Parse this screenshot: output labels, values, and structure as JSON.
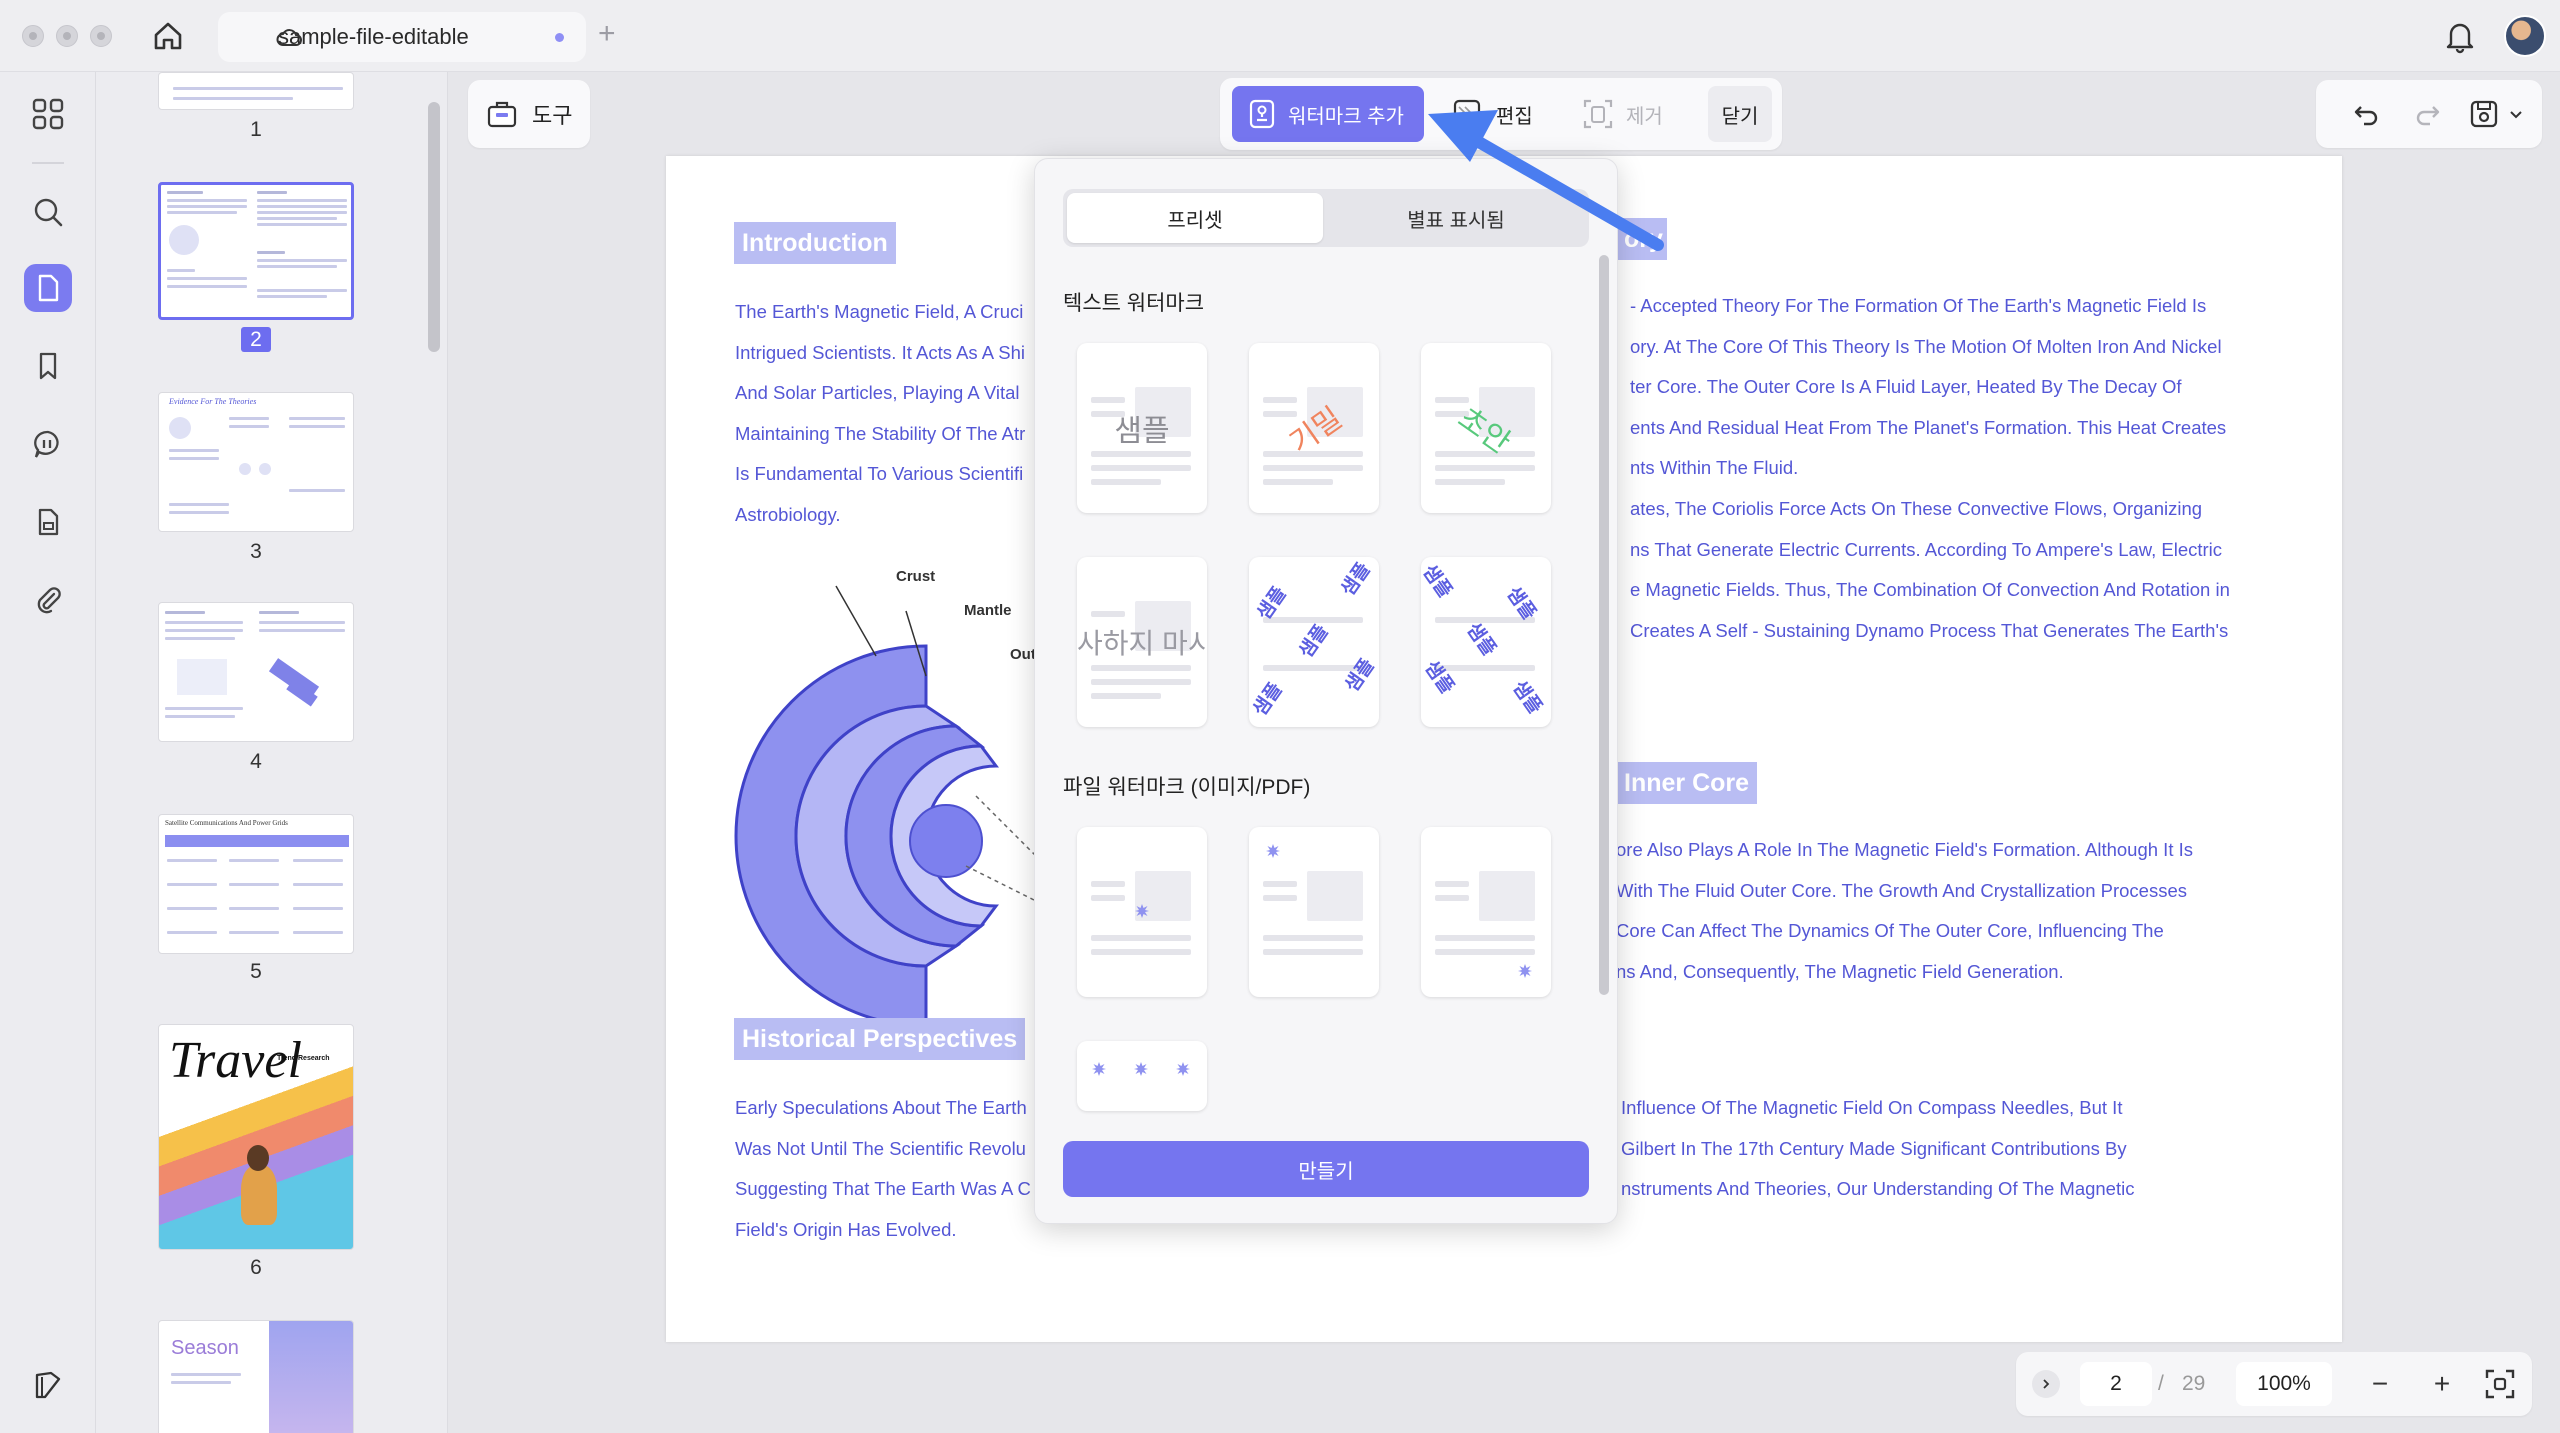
{
  "titlebar": {
    "tab_title": "sample-file-editable",
    "new_tab_symbol": "+"
  },
  "rail": {
    "icons": [
      "grid-icon",
      "search-icon",
      "page-icon",
      "bookmark-icon",
      "comment-icon",
      "form-icon",
      "attachment-icon",
      "layers-icon"
    ]
  },
  "thumbnails": {
    "pages": [
      "1",
      "2",
      "3",
      "4",
      "5",
      "6"
    ],
    "selected": "2",
    "page3_title": "Evidence For The Theories",
    "page5_title": "Satellite Communications And Power Grids",
    "page6_title": "Travel",
    "page6_subtitle": "Trend Research",
    "page7_title": "Season"
  },
  "toolbar": {
    "tools_label": "도구",
    "add_watermark_label": "워터마크 추가",
    "edit_label": "편집",
    "remove_label": "제거",
    "close_label": "닫기"
  },
  "document": {
    "intro_heading": "Introduction",
    "intro_lines": [
      "The Earth's Magnetic Field, A Cruci",
      "Intrigued Scientists. It Acts As A Shi",
      "And Solar Particles, Playing A Vital",
      "Maintaining The Stability Of The Atr",
      "Is Fundamental To Various Scientifi",
      "Astrobiology."
    ],
    "diagram_labels": {
      "crust": "Crust",
      "mantle": "Mantle",
      "outer": "Out"
    },
    "theory_heading_fragment": "ory",
    "theory_lines": [
      "- Accepted Theory For The Formation Of The Earth's Magnetic Field Is",
      "ory. At The Core Of This Theory Is The Motion Of Molten Iron And Nickel",
      "ter Core. The Outer Core Is A Fluid Layer, Heated By The Decay Of",
      "ents And Residual Heat From The Planet's Formation. This Heat Creates",
      "nts Within The Fluid.",
      "ates, The Coriolis Force Acts On These Convective Flows, Organizing",
      "ns That Generate Electric Currents. According To Ampere's Law, Electric",
      "e Magnetic Fields. Thus, The Combination Of Convection And Rotation in",
      "Creates A Self - Sustaining Dynamo Process That Generates The Earth's"
    ],
    "inner_core_heading": "Inner Core",
    "inner_core_lines": [
      "ore Also Plays A Role In The Magnetic Field's Formation. Although It Is",
      "With The Fluid Outer Core. The Growth And Crystallization Processes",
      "Core Can Affect The Dynamics Of The Outer Core, Influencing The",
      "ns And, Consequently, The Magnetic Field Generation."
    ],
    "history_heading": "Historical Perspectives",
    "history_left_lines": [
      "Early Speculations About The Earth",
      "Was Not Until The Scientific Revolu",
      "Suggesting That The Earth Was A C",
      "Field's Origin Has Evolved."
    ],
    "history_right_lines": [
      "Influence Of The Magnetic Field On Compass Needles, But It",
      "Gilbert In The 17th Century Made Significant Contributions By",
      "nstruments And Theories, Our Understanding Of The Magnetic"
    ]
  },
  "popup": {
    "tab_preset": "프리셋",
    "tab_separate": "별표 표시됨",
    "text_section_title": "텍스트 워터마크",
    "text_presets": [
      "샘플",
      "기밀",
      "초안",
      "사하지 마시"
    ],
    "tile_word": "샘플",
    "file_section_title": "파일 워터마크 (이미지/PDF)",
    "create_label": "만들기"
  },
  "pager": {
    "current_page": "2",
    "separator": "/",
    "total_pages": "29",
    "zoom": "100%",
    "zoom_out": "−",
    "zoom_in": "+"
  },
  "colors": {
    "accent": "#7575ef",
    "doc_text": "#5457d6",
    "heading_bg": "#b9bdf3"
  }
}
